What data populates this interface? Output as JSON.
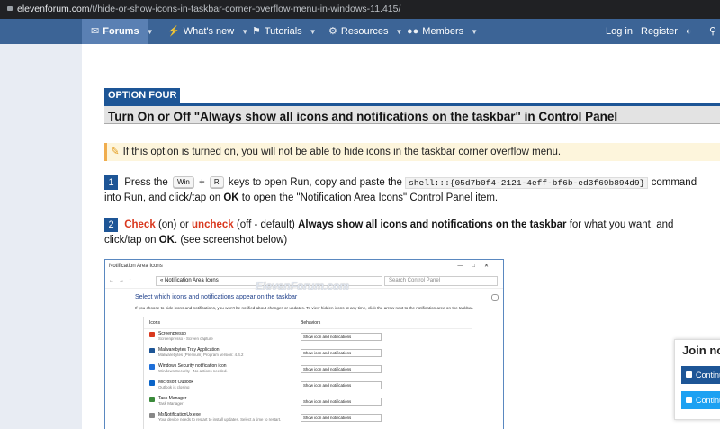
{
  "browser": {
    "url_domain": "elevenforum.com",
    "url_path": "/t/hide-or-show-icons-in-taskbar-corner-overflow-menu-in-windows-11.415/"
  },
  "nav": {
    "forums": "Forums",
    "whats_new": "What's new",
    "tutorials": "Tutorials",
    "resources": "Resources",
    "members": "Members",
    "login": "Log in",
    "register": "Register"
  },
  "article": {
    "option_label": "OPTION FOUR",
    "heading": "Turn On or Off \"Always show all icons and notifications on the taskbar\" in Control Panel",
    "note": "If this option is turned on, you will not be able to hide icons in the taskbar corner overflow menu.",
    "step1": {
      "num": "1",
      "press": "Press the",
      "key1": "Win",
      "plus": "+",
      "key2": "R",
      "mid": "keys to open Run, copy and paste the",
      "command": "shell:::{05d7b0f4-2121-4eff-bf6b-ed3f69b894d9}",
      "rest1": "command into Run, and click/tap on",
      "ok": "OK",
      "rest2": "to open the \"Notification Area Icons\" Control Panel item."
    },
    "step2": {
      "num": "2",
      "check": "Check",
      "on": "(on) or",
      "uncheck": "uncheck",
      "off": "(off - default)",
      "setting": "Always show all icons and notifications on the taskbar",
      "rest1": "for what you want, and click/tap on",
      "ok": "OK",
      "rest2": ". (see screenshot below)"
    }
  },
  "screenshot": {
    "window_title": "Notification Area Icons",
    "address": "« Notification Area Icons",
    "search_placeholder": "Search Control Panel",
    "watermark": "ElevenForum.com",
    "title": "Select which icons and notifications appear on the taskbar",
    "description": "If you choose to hide icons and notifications, you won’t be notified about changes or updates. To view hidden icons at any time, click the arrow next to the notification area on the taskbar.",
    "col_icons": "Icons",
    "col_behaviors": "Behaviors",
    "rows": [
      {
        "name": "Screenpresso",
        "sub": "Screenpresso - Screen capture",
        "behavior": "Show icon and notifications",
        "color": "#d9381e"
      },
      {
        "name": "Malwarebytes Tray Application",
        "sub": "Malwarebytes (Premium) Program version: 4.4.2",
        "behavior": "Show icon and notifications",
        "color": "#1d5596"
      },
      {
        "name": "Windows Security notification icon",
        "sub": "Windows Security - No actions needed.",
        "behavior": "Show icon and notifications",
        "color": "#1e6fd9"
      },
      {
        "name": "Microsoft Outlook",
        "sub": "Outlook is closing",
        "behavior": "Show icon and notifications",
        "color": "#0a64c8"
      },
      {
        "name": "Task Manager",
        "sub": "Task Manager",
        "behavior": "Show icon and notifications",
        "color": "#3a8a3a"
      },
      {
        "name": "MsNotificationUx.exe",
        "sub": "Your device needs to restart to install updates. Select a time to restart.",
        "behavior": "Show icon and notifications",
        "color": "#888888"
      }
    ]
  },
  "join": {
    "title": "Join no",
    "btn1": "Continue",
    "btn2": "Continue"
  }
}
